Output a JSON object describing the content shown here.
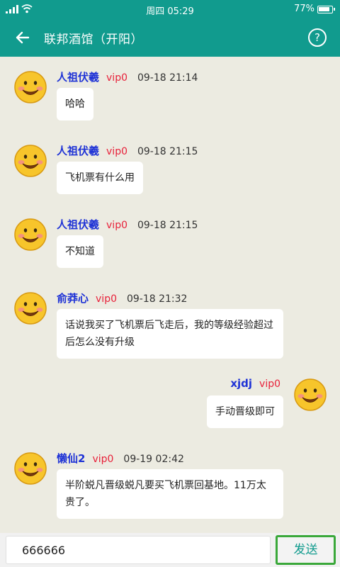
{
  "status": {
    "clock": "周四 05:29",
    "battery": "77%"
  },
  "header": {
    "title": "联邦酒馆（开阳）"
  },
  "messages": [
    {
      "name": "人祖伏羲",
      "vip": "vip0",
      "time": "09-18 21:14",
      "text": "哈哈"
    },
    {
      "name": "人祖伏羲",
      "vip": "vip0",
      "time": "09-18 21:15",
      "text": "飞机票有什么用"
    },
    {
      "name": "人祖伏羲",
      "vip": "vip0",
      "time": "09-18 21:15",
      "text": "不知道"
    },
    {
      "name": "俞莽心",
      "vip": "vip0",
      "time": "09-18 21:32",
      "text": "话说我买了飞机票后飞走后，我的等级经验超过后怎么没有升级"
    },
    {
      "name": "xjdj",
      "vip": "vip0",
      "time": "",
      "text": "手动晋级即可"
    },
    {
      "name": "懒仙2",
      "vip": "vip0",
      "time": "09-19 02:42",
      "text": "半阶蜕凡晋级蜕凡要买飞机票回基地。11万太贵了。"
    }
  ],
  "composer": {
    "value": "666666",
    "send_label": "发送"
  },
  "icons": {
    "signal": "signal-icon",
    "wifi": "wifi-icon",
    "battery": "battery-icon",
    "back": "back-arrow-icon",
    "help": "help-icon",
    "avatar": "smiley-avatar-icon"
  },
  "colors": {
    "primary": "#119b8e",
    "name": "#1f33d6",
    "vip": "#e8213a",
    "send_border": "#3aa83a",
    "background": "#ecebe1"
  }
}
